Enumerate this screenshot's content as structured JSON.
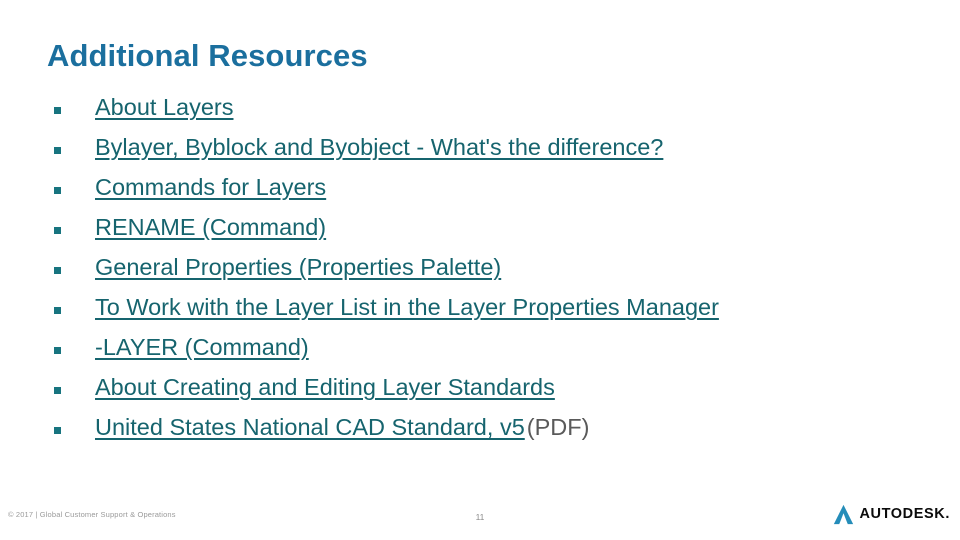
{
  "slide": {
    "title": "Additional Resources",
    "title_color": "#1B6F9E",
    "link_color": "#16646E",
    "bullet_color": "#17747F",
    "background": "#ffffff"
  },
  "bullets": [
    {
      "text": "About Layers",
      "suffix": ""
    },
    {
      "text": "Bylayer, Byblock and Byobject - What's the difference?",
      "suffix": ""
    },
    {
      "text": "Commands for Layers",
      "suffix": ""
    },
    {
      "text": "RENAME (Command)",
      "suffix": ""
    },
    {
      "text": "General Properties (Properties Palette)",
      "suffix": ""
    },
    {
      "text": "To Work with the Layer List in the Layer Properties Manager",
      "suffix": ""
    },
    {
      "text": "-LAYER (Command)",
      "suffix": ""
    },
    {
      "text": "About Creating and Editing Layer Standards",
      "suffix": ""
    },
    {
      "text": "United States National CAD Standard, v5",
      "suffix": "(PDF)"
    }
  ],
  "footer": {
    "copyright": "© 2017 | Global Customer Support & Operations",
    "page_number": "11",
    "logo_wordmark": "AUTODESK.",
    "logo_icon": "autodesk-a-mark-icon"
  }
}
